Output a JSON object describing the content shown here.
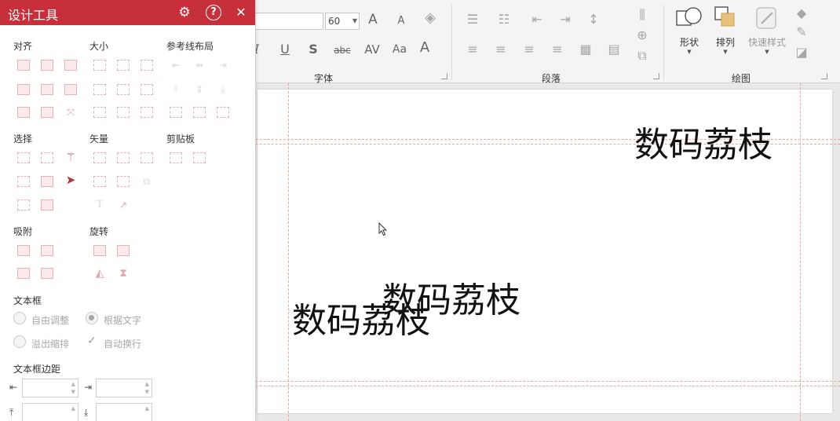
{
  "panel": {
    "title": "设计工具",
    "settings_icon": "gear-icon",
    "help_icon": "help-icon",
    "close_icon": "close-icon",
    "sections": {
      "align": "对齐",
      "size": "大小",
      "guides": "参考线布局",
      "select": "选择",
      "vector": "矢量",
      "clipboard": "剪贴板",
      "snap": "吸附",
      "rotate": "旋转",
      "textbox": "文本框",
      "margin": "文本框边距"
    },
    "textbox_options": {
      "free_adjust": "自由调整",
      "fit_text": "根据文字",
      "overflow_shrink": "溢出缩排",
      "auto_wrap": "自动换行"
    },
    "margins": {
      "left": "",
      "right": "",
      "top": "",
      "bottom": ""
    }
  },
  "ribbon": {
    "font_size": "60",
    "groups": {
      "font": "字体",
      "paragraph": "段落",
      "drawing": "绘图"
    },
    "buttons": {
      "shape": "形状",
      "arrange": "排列",
      "quick_style": "快速样式"
    },
    "font_glyphs": {
      "grow": "A",
      "shrink": "A",
      "italic": "I",
      "underline": "U",
      "shadow": "S",
      "strike": "abc",
      "spacing": "AV",
      "case": "Aa",
      "color": "A"
    }
  },
  "slide": {
    "texts": [
      "数码荔枝",
      "数码荔枝",
      "数码荔枝"
    ]
  },
  "colors": {
    "accent": "#c7303b",
    "icon_tint": "#e2a6ab",
    "guide": "#e8a8a0"
  }
}
